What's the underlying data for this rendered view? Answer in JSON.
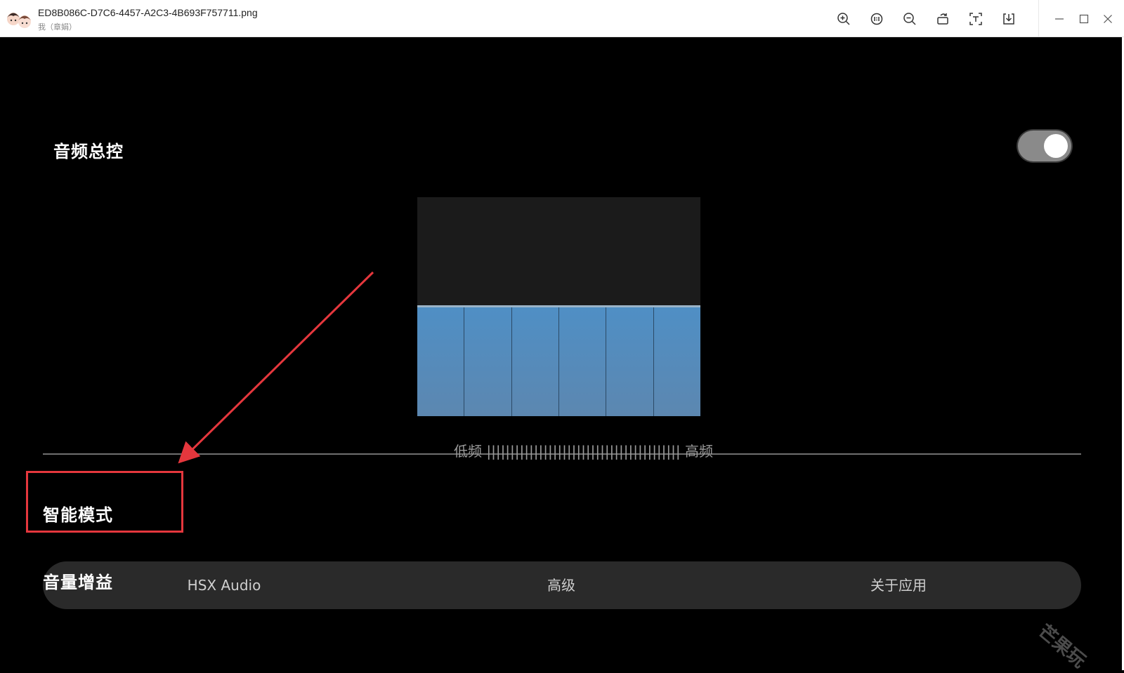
{
  "titlebar": {
    "file_name": "ED8B086C-D7C6-4457-A2C3-4B693F757711.png",
    "owner": "我（章娟）",
    "tools": [
      "zoom-in-icon",
      "actual-size-icon",
      "zoom-out-icon",
      "rotate-icon",
      "extract-text-icon",
      "download-icon"
    ],
    "window": [
      "minimize-icon",
      "maximize-icon",
      "close-icon"
    ]
  },
  "screen": {
    "master_title": "音频总控",
    "master_toggle_on": true,
    "eq": {
      "bands": 6,
      "level_fraction": 0.5,
      "band_colors": [
        "#4f8fc5",
        "#5c87b0"
      ]
    },
    "freq_range_label": "低频 ||||||||||||||||||||||||||||||||||||||||| 高频",
    "smart_mode_title": "智能模式",
    "volume_gain_title": "音量增益",
    "nav": {
      "items": [
        "HSX Audio",
        "高级",
        "关于应用"
      ]
    },
    "annotation_color": "#e5373d",
    "watermark": "芒果玩"
  }
}
